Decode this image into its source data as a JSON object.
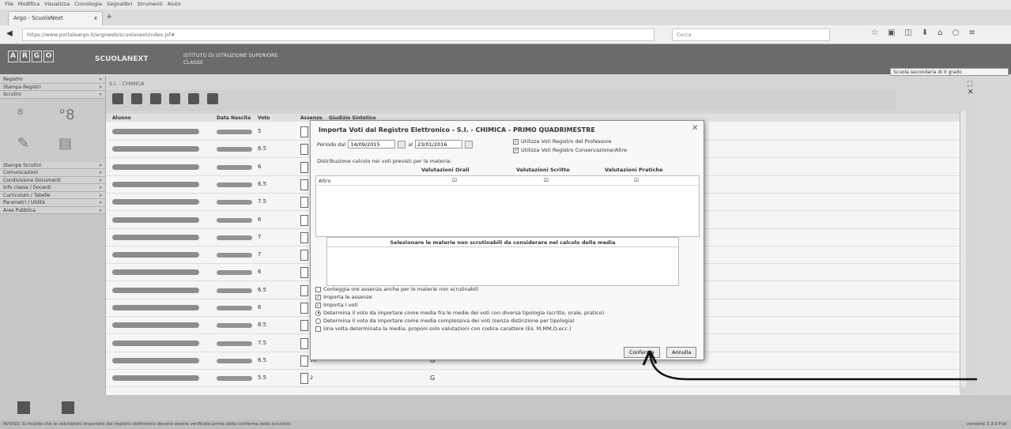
{
  "browser": {
    "menu": [
      "File",
      "Modifica",
      "Visualizza",
      "Cronologia",
      "Segnalibri",
      "Strumenti",
      "Aiuto"
    ],
    "tab_title": "Argo - ScuolaNext",
    "tab_close": "x",
    "new_tab": "+",
    "url": "https://www.portaleargo.it/argoweb/scuolanext/index.jsf#",
    "search_placeholder": "Cerca",
    "toolbar_icons": [
      "star-icon",
      "bookmark-icon",
      "pocket-icon",
      "download-icon",
      "home-icon",
      "chat-icon",
      "menu-icon"
    ]
  },
  "app": {
    "logo_letters": [
      "A",
      "R",
      "G",
      "O"
    ],
    "name": "SCUOLANEXT",
    "school_line1": "ISTITUTO DI ISTRUZIONE SUPERIORE",
    "school_line2": "CLASSE",
    "school_select": "Scuola secondaria di II grado"
  },
  "sidebar": {
    "top_items": [
      {
        "label": "Registro",
        "marker": "«"
      },
      {
        "label": "Stampa Registri",
        "marker": "»"
      },
      {
        "label": "Scrutini",
        "marker": "«"
      }
    ],
    "bottom_items": [
      {
        "label": "Stampe Scrutini",
        "marker": "»"
      },
      {
        "label": "Comunicazioni",
        "marker": "»"
      },
      {
        "label": "Condivisione Documenti",
        "marker": "»"
      },
      {
        "label": "Info classe / Docenti",
        "marker": "»"
      },
      {
        "label": "Curriculum / Tabelle",
        "marker": "»"
      },
      {
        "label": "Parametri / Utilità",
        "marker": "»"
      },
      {
        "label": "Area Pubblica",
        "marker": "»"
      }
    ]
  },
  "main": {
    "breadcrumb": "S.I. - CHIMICA",
    "columns": [
      "Alunno",
      "Data Nascita",
      "Voto",
      "Assenze",
      "Giudizio Sintetico"
    ],
    "rows": [
      {
        "voto": "5",
        "val": "",
        "g": ""
      },
      {
        "voto": "6.5",
        "val": "",
        "g": ""
      },
      {
        "voto": "6",
        "val": "",
        "g": ""
      },
      {
        "voto": "6.5",
        "val": "",
        "g": ""
      },
      {
        "voto": "7.5",
        "val": "",
        "g": ""
      },
      {
        "voto": "6",
        "val": "",
        "g": ""
      },
      {
        "voto": "7",
        "val": "",
        "g": ""
      },
      {
        "voto": "7",
        "val": "",
        "g": ""
      },
      {
        "voto": "6",
        "val": "",
        "g": ""
      },
      {
        "voto": "6.5",
        "val": "",
        "g": ""
      },
      {
        "voto": "6",
        "val": "",
        "g": ""
      },
      {
        "voto": "8.5",
        "val": "",
        "g": ""
      },
      {
        "voto": "7.5",
        "val": "",
        "g": ""
      },
      {
        "voto": "6.5",
        "val": "10",
        "g": "G"
      },
      {
        "voto": "5.5",
        "val": "2",
        "g": "G"
      }
    ],
    "panel_controls": "⛶ ✕"
  },
  "dialog": {
    "title": "Importa Voti dal Registro Elettronico - S.I. - CHIMICA - PRIMO QUADRIMESTRE",
    "close": "✕",
    "period_label": "Periodo dal",
    "date_from": "14/09/2015",
    "to_label": "al",
    "date_to": "23/01/2016",
    "check_professor": "Utilizza Voti Registro del Professore",
    "check_conservation": "Utilizza Voti Registro Conservazione/Altre",
    "distribution": "Distribuzione calcolo nei voti previsti per la materia:",
    "col_oral": "Valutazioni Orali",
    "col_written": "Valutazioni Scritte",
    "col_practical": "Valutazioni Pratiche",
    "row_label": "Altro",
    "row_mark": "☑",
    "subjects_header": "Selezionare le materie non scrutinabili da considerare nel calcolo della media",
    "option_conteggia": "Conteggia ore assenza anche per le materie non scrutinabili",
    "option_importa_assenze": "Importa le assenze",
    "option_importa_voti": "Importa i voti",
    "option_media_tipologia": "Determina il voto da importare come media fra le medie dei voti con diversa tipologia (scritto, orale, pratico)",
    "option_media_complessiva": "Determina il voto da importare come media complessiva dei voti (senza distinzione per tipologia)",
    "option_solo_valutazioni": "Una volta determinata la media, proponi solo valutazioni con codice carattere (Es. M,MM,O,ecc.)",
    "confirm": "Conferma",
    "cancel": "Annulla"
  },
  "status": {
    "text": "AVVISO: Si ricorda che le valutazioni importate dal registro elettronico devono essere verificate prima della conferma dello scrutinio.",
    "version": "versione 3.3.0 Full"
  }
}
